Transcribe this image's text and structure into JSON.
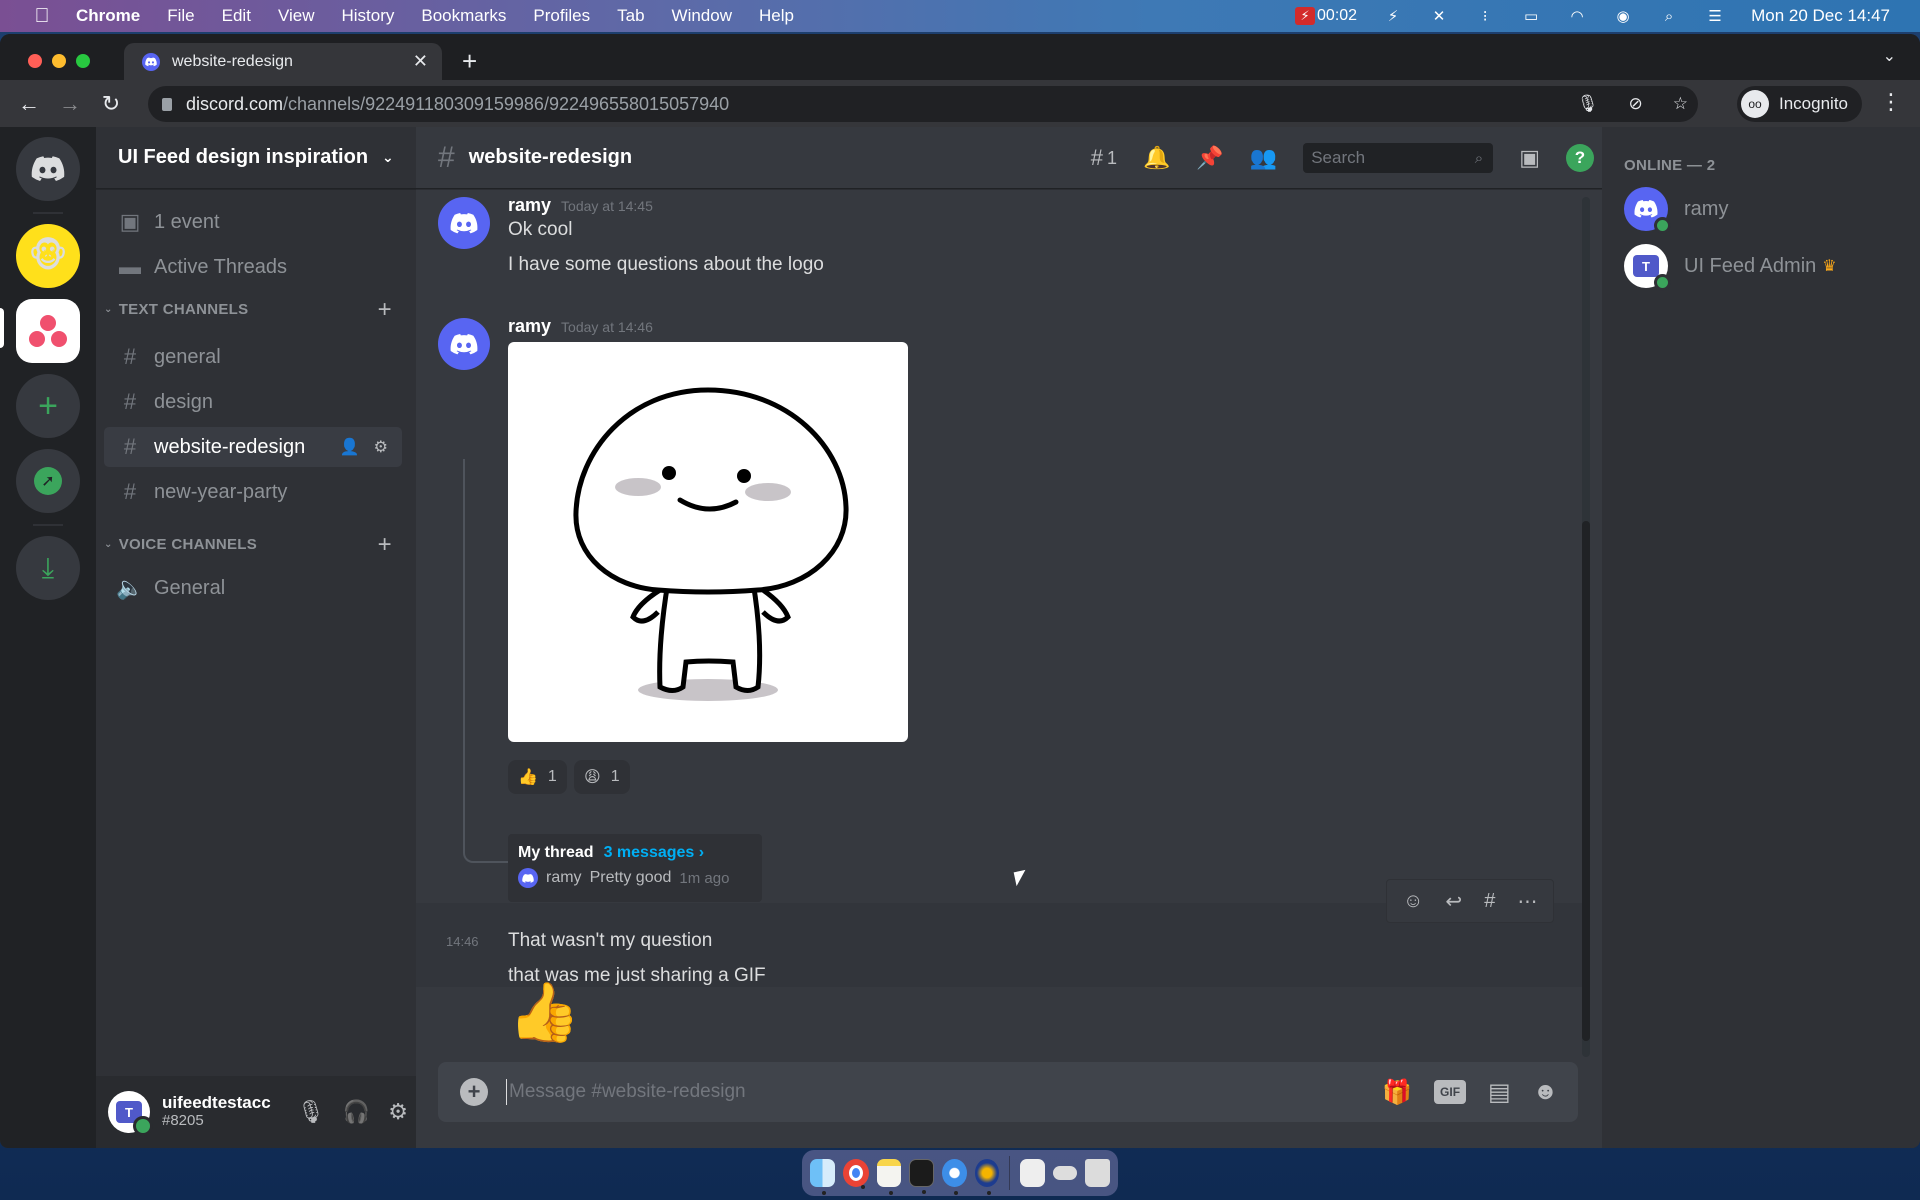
{
  "mac_menubar": {
    "app_name": "Chrome",
    "menus": [
      "File",
      "Edit",
      "View",
      "History",
      "Bookmarks",
      "Profiles",
      "Tab",
      "Window",
      "Help"
    ],
    "recording_time": "00:02",
    "datetime": "Mon 20 Dec  14:47"
  },
  "browser": {
    "tab_title": "website-redesign",
    "url_host": "discord.com",
    "url_path": "/channels/922491180309159986/922496558015057940",
    "profile_label": "Incognito"
  },
  "server": {
    "name": "UI Feed design inspiration",
    "event_label": "1 event",
    "threads_label": "Active Threads",
    "text_category": "TEXT CHANNELS",
    "voice_category": "VOICE CHANNELS",
    "text_channels": [
      {
        "name": "general"
      },
      {
        "name": "design"
      },
      {
        "name": "website-redesign",
        "active": true
      },
      {
        "name": "new-year-party"
      }
    ],
    "voice_channels": [
      {
        "name": "General"
      }
    ]
  },
  "user": {
    "name": "uifeedtestacc",
    "discriminator": "#8205"
  },
  "channel": {
    "name": "website-redesign",
    "threads_count": "1",
    "search_placeholder": "Search",
    "composer_placeholder": "Message #website-redesign"
  },
  "messages": [
    {
      "author": "ramy",
      "timestamp": "Today at 14:45",
      "lines": [
        "Ok cool",
        "I have some questions about the logo"
      ]
    },
    {
      "author": "ramy",
      "timestamp": "Today at 14:46",
      "attachment": "gif",
      "reactions": [
        {
          "emoji": "👍",
          "count": "1"
        },
        {
          "emoji": "😩",
          "count": "1"
        }
      ],
      "thread": {
        "name": "My thread",
        "count_label": "3 messages ›",
        "last_author": "ramy",
        "last_text": "Pretty good",
        "last_time": "1m ago"
      }
    },
    {
      "short_time": "14:46",
      "lines": [
        "That wasn't my question",
        "that was me just sharing a GIF"
      ],
      "big_emoji": "👍"
    }
  ],
  "members": {
    "header": "ONLINE — 2",
    "list": [
      {
        "name": "ramy",
        "status": "online"
      },
      {
        "name": "UI Feed Admin",
        "status": "online",
        "owner": true
      }
    ]
  },
  "colors": {
    "blurple": "#5865f2",
    "online": "#3ba55c",
    "link": "#00aff4",
    "owner_crown": "#faa81a"
  }
}
